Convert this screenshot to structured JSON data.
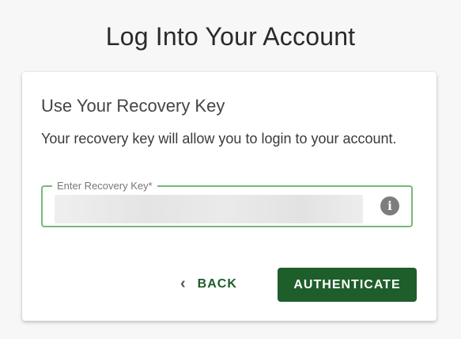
{
  "page": {
    "title": "Log Into Your Account"
  },
  "card": {
    "title": "Use Your Recovery Key",
    "description": "Your recovery key will allow you to login to your account.",
    "recovery_field": {
      "label": "Enter Recovery Key*",
      "value": "",
      "info_icon": "info-circle-icon"
    },
    "back_label": "BACK",
    "back_icon": "chevron-left-icon",
    "authenticate_label": "AUTHENTICATE"
  },
  "colors": {
    "primary": "#1d5e2a",
    "field_border": "#76b87a",
    "background": "#f7f7f7",
    "info_icon": "#7d7d7d"
  }
}
